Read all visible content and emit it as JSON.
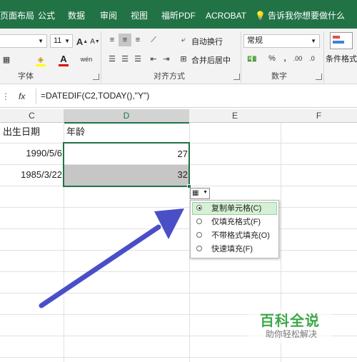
{
  "ribbon_tabs": [
    "页面布局",
    "公式",
    "数据",
    "审阅",
    "视图",
    "福昕PDF",
    "ACROBAT"
  ],
  "tell_me": "告诉我你想要做什么",
  "font": {
    "size": "11"
  },
  "alignment": {
    "wrap_text": "自动换行",
    "merge_center": "合并后居中"
  },
  "number": {
    "format": "常规",
    "percent": "%",
    "comma": ",",
    "dec_inc": ".00"
  },
  "styles": {
    "conditional_format": "条件格式"
  },
  "group_labels": {
    "font": "字体",
    "alignment": "对齐方式",
    "number": "数字"
  },
  "formula_bar": {
    "fx": "fx",
    "formula": "=DATEDIF(C2,TODAY(),\"Y\")"
  },
  "columns": [
    "C",
    "D",
    "E",
    "F"
  ],
  "cells": {
    "c1": "出生日期",
    "d1": "年龄",
    "c2": "1990/5/6",
    "d2": "27",
    "c3": "1985/3/22",
    "d3": "32"
  },
  "autofill": {
    "options": [
      "复制单元格(C)",
      "仅填充格式(F)",
      "不带格式填充(O)",
      "快速填充(F)"
    ],
    "selected_index": 0
  },
  "watermark": {
    "title": "百科全说",
    "subtitle": "助你轻松解决"
  },
  "colors": {
    "ribbon_green": "#217346",
    "arrow": "#4a4fc7",
    "selection": "#217346",
    "selected_cell": "#c6c6c6"
  }
}
